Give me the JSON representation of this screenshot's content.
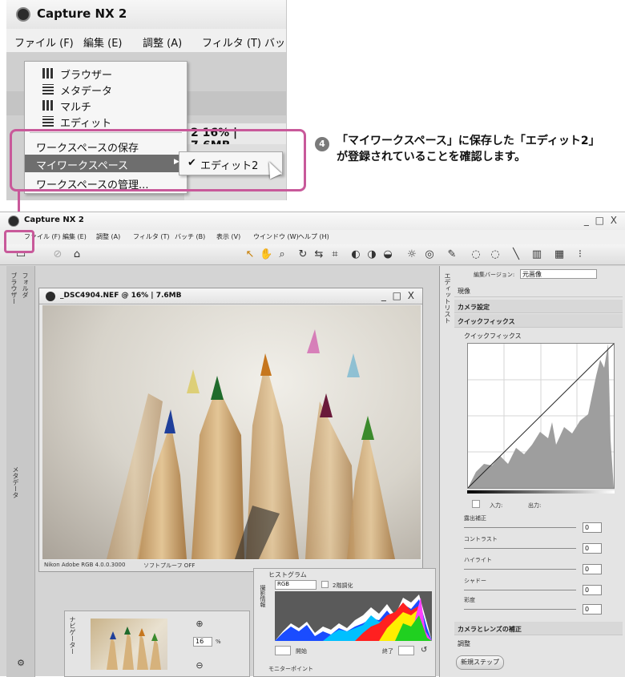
{
  "top": {
    "title": "Capture NX 2",
    "menus": [
      "ファイル (F)",
      "編集 (E)",
      "調整 (A)",
      "フィルタ (T)",
      "バッ"
    ],
    "zoom_label": "2 16% | 7.6MB",
    "view_menu": [
      "ブラウザー",
      "メタデータ",
      "マルチ",
      "エディット"
    ],
    "workspace_menu": [
      "ワークスペースの保存",
      "マイワークスペース",
      "ワークスペースの管理..."
    ],
    "submenu_item": "エディット2",
    "submenu_check": "✔"
  },
  "callout": {
    "step": "4",
    "text": "「マイワークスペース」に保存した「エディット2」が登録されていることを確認します。"
  },
  "app": {
    "title": "Capture NX 2",
    "window_controls": "_ □ X",
    "menus": [
      "ファイル (F)",
      "編集 (E)",
      "調整 (A)",
      "フィルタ (T)",
      "バッチ (B)",
      "表示 (V)",
      "ウインドウ (W)",
      "ヘルプ (H)"
    ],
    "left_tabs": [
      "ブラウザー",
      "フォルダ",
      "メタデータ"
    ],
    "nav_tab": "ナビゲーター"
  },
  "image_window": {
    "title": "_DSC4904.NEF @ 16% | 7.6MB",
    "controls": "_ □ X",
    "profile": "Nikon Adobe RGB 4.0.0.3000",
    "softproof": "ソフトプルーフ OFF"
  },
  "histogram": {
    "header": "ヒストグラム",
    "channel": "RGB",
    "two_tone": "2階調化",
    "start_label": "開始",
    "end_label": "終了",
    "monitor_point": "モニターポイント",
    "side_tab": "撮影情報"
  },
  "navigator": {
    "zoom": "16",
    "unit": "%"
  },
  "edit_panel": {
    "side_tab": "エディットリスト",
    "version_label": "編集バージョン:",
    "version_value": "元画像",
    "develop": "現像",
    "camera_settings": "カメラ設定",
    "quick_fix": "クイックフィックス",
    "quick_fix_sub": "クイックフィックス",
    "input_label": "入力:",
    "output_label": "出力:",
    "sliders": [
      {
        "label": "露出補正",
        "value": "0"
      },
      {
        "label": "コントラスト",
        "value": "0"
      },
      {
        "label": "ハイライト",
        "value": "0"
      },
      {
        "label": "シャドー",
        "value": "0"
      },
      {
        "label": "彩度",
        "value": "0"
      }
    ],
    "lens": "カメラとレンズの補正",
    "adjust": "調整",
    "new_step": "新規ステップ"
  }
}
